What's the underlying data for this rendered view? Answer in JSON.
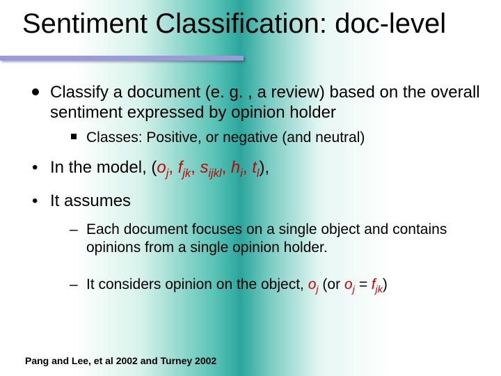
{
  "title": {
    "main": "Sentiment Classification",
    "sub": ": doc-level"
  },
  "b1": {
    "prefix": "Classify a document",
    "rest": " (e. g. , a review) based on the overall sentiment expressed by opinion holder",
    "sub1_prefix": "Classes:",
    "sub1_rest": " Positive, or negative (and neutral)"
  },
  "b2": {
    "prefix": "In the model, (",
    "v1": "o",
    "s1": "j",
    "c1": ", ",
    "v2": "f",
    "s2": "jk",
    "c2": ", ",
    "v3": "s",
    "s3": "ijkl",
    "c3": ", ",
    "v4": "h",
    "s4": "i",
    "c4": ", ",
    "v5": "t",
    "s5": "l",
    "suffix": "),"
  },
  "b3": {
    "text": "It assumes",
    "sub1": "Each document focuses on a single object and contains opinions from a single opinion holder.",
    "sub2_prefix": "It considers opinion on the object, ",
    "sub2_v1": "o",
    "sub2_s1": "j",
    "sub2_mid": " (or ",
    "sub2_v2": "o",
    "sub2_s2": "j",
    "sub2_eq": " = ",
    "sub2_v3": "f",
    "sub2_s3": "jk",
    "sub2_end": ")"
  },
  "footer": "Pang  and Lee, et al 2002 and Turney 2002"
}
